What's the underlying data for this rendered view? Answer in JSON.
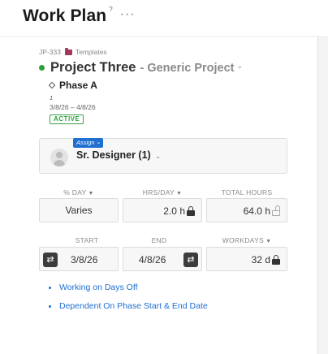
{
  "header": {
    "title": "Work Plan",
    "help_glyph": "?",
    "more_glyph": "···"
  },
  "breadcrumb": {
    "project_id": "JP-333",
    "folder": "Templates"
  },
  "project": {
    "name": "Project Three",
    "type": "- Generic Project",
    "chevron": "⌄",
    "status_color": "#2e9e3c"
  },
  "phase": {
    "name": "Phase A",
    "number": "1",
    "date_range": "3/8/26 – 4/8/26",
    "status": "ACTIVE"
  },
  "assignment": {
    "tag_label": "Assign",
    "role_label": "Sr. Designer (1)",
    "chevron": "⌄"
  },
  "hours": {
    "pct_day_label": "% DAY",
    "hrs_day_label": "HRS/DAY",
    "total_hours_label": "TOTAL HOURS",
    "pct_day_value": "Varies",
    "hrs_day_value": "2.0 h",
    "total_hours_value": "64.0 h"
  },
  "schedule": {
    "start_label": "START",
    "end_label": "END",
    "workdays_label": "WORKDAYS",
    "start_value": "3/8/26",
    "end_value": "4/8/26",
    "workdays_value": "32 d"
  },
  "links": [
    "Working on Days Off",
    "Dependent On Phase Start & End Date"
  ],
  "colors": {
    "accent": "#1f6fd1",
    "active_green": "#2e9e3c",
    "folder": "#a2395b"
  },
  "icons": [
    "help-icon",
    "more-icon",
    "folder-icon",
    "diamond-icon",
    "avatar-icon",
    "lock-icon",
    "unlock-icon",
    "swap-icon"
  ]
}
